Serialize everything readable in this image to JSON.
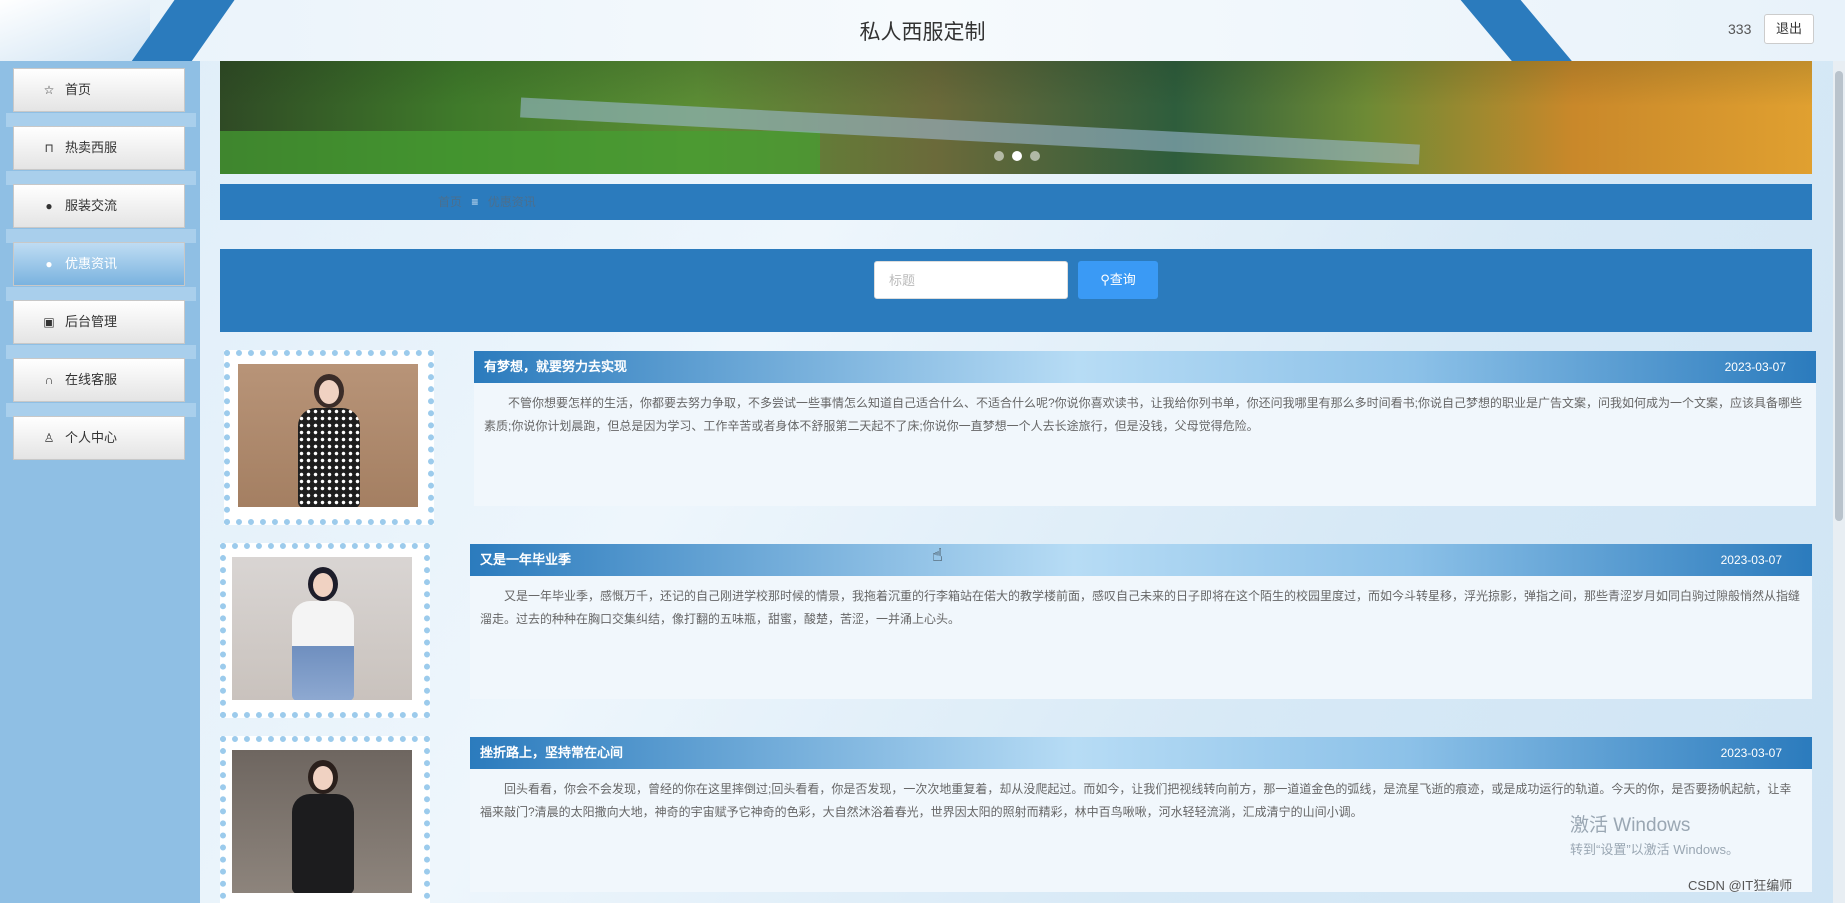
{
  "header": {
    "title": "私人西服定制",
    "user": "333",
    "logout_label": "退出"
  },
  "sidebar": {
    "items": [
      {
        "label": "首页",
        "icon": "star-icon"
      },
      {
        "label": "热卖西服",
        "icon": "bag-icon"
      },
      {
        "label": "服装交流",
        "icon": "info-icon"
      },
      {
        "label": "优惠资讯",
        "icon": "dot-icon",
        "active": true
      },
      {
        "label": "后台管理",
        "icon": "briefcase-icon"
      },
      {
        "label": "在线客服",
        "icon": "headset-icon"
      },
      {
        "label": "个人中心",
        "icon": "user-icon"
      }
    ]
  },
  "banner": {
    "slide_count": 3,
    "active_slide": 2
  },
  "breadcrumb": {
    "home": "首页",
    "separator": "≡",
    "current": "优惠资讯"
  },
  "search": {
    "placeholder": "标题",
    "value": "",
    "button_label": "查询"
  },
  "news": [
    {
      "title": "有梦想，就要努力去实现",
      "date": "2023-03-07",
      "content": "不管你想要怎样的生活，你都要去努力争取，不多尝试一些事情怎么知道自己适合什么、不适合什么呢?你说你喜欢读书，让我给你列书单，你还问我哪里有那么多时间看书;你说自己梦想的职业是广告文案，问我如何成为一个文案，应该具备哪些素质;你说你计划晨跑，但总是因为学习、工作辛苦或者身体不舒服第二天起不了床;你说你一直梦想一个人去长途旅行，但是没钱，父母觉得危险。"
    },
    {
      "title": "又是一年毕业季",
      "date": "2023-03-07",
      "content": "又是一年毕业季，感慨万千，还记的自己刚进学校那时候的情景，我拖着沉重的行李箱站在偌大的教学楼前面，感叹自己未来的日子即将在这个陌生的校园里度过，而如今斗转星移，浮光掠影，弹指之间，那些青涩岁月如同白驹过隙般悄然从指缝溜走。过去的种种在胸口交集纠结，像打翻的五味瓶，甜蜜，酸楚，苦涩，一并涌上心头。"
    },
    {
      "title": "挫折路上，坚持常在心间",
      "date": "2023-03-07",
      "content": "回头看看，你会不会发现，曾经的你在这里摔倒过;回头看看，你是否发现，一次次地重复着，却从没爬起过。而如今，让我们把视线转向前方，那一道道金色的弧线，是流星飞逝的痕迹，或是成功运行的轨道。今天的你，是否要扬帆起航，让幸福来敲门?清晨的太阳撒向大地，神奇的宇宙赋予它神奇的色彩，大自然沐浴着春光，世界因太阳的照射而精彩，林中百鸟啾啾，河水轻轻流淌，汇成清宁的山间小调。"
    }
  ],
  "watermark": {
    "line1": "激活 Windows",
    "line2": "转到“设置”以激活 Windows。"
  },
  "footer_mark": "CSDN @IT狂编师",
  "colors": {
    "primary": "#2b7bbd",
    "sidebar": "#8fbfe4",
    "search_button": "#3a9af5"
  }
}
